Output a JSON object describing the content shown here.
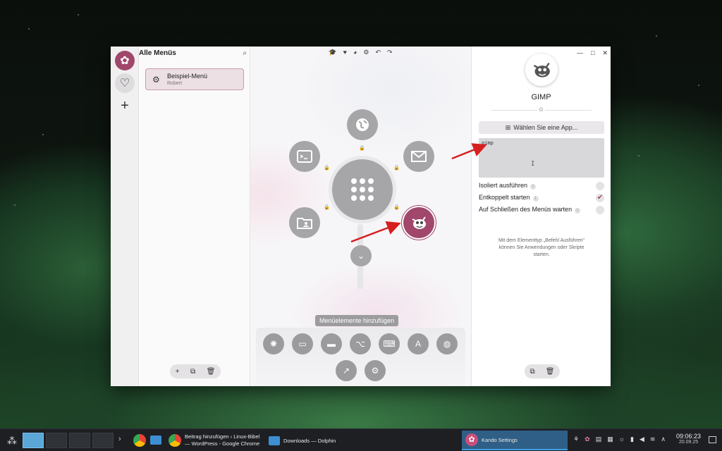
{
  "window": {
    "panel_title": "Alle Menüs",
    "menus": [
      {
        "name": "Beispiel-Menü",
        "subtitle": "Robert"
      }
    ]
  },
  "canvas": {
    "add_items_label": "Menüelemente hinzufügen"
  },
  "properties": {
    "item_name": "GIMP",
    "choose_app_label": "Wählen Sie eine App...",
    "command_value": "gimp",
    "options": [
      {
        "label": "Isoliert ausführen",
        "checked": false
      },
      {
        "label": "Entkoppelt starten",
        "checked": true
      },
      {
        "label": "Auf Schließen des Menüs warten",
        "checked": false
      }
    ],
    "hint": "Mit dem Elementtyp „Befehl Ausführen\" können Sie Anwendungen oder Skripte starten."
  },
  "taskbar": {
    "tasks": [
      {
        "label": "Beitrag hinzufügen ‹ Linux-Bibel — WordPress - Google Chrome"
      },
      {
        "label": "Downloads — Dolphin"
      },
      {
        "label": "Kando Settings"
      }
    ],
    "clock_time": "09:06:23",
    "clock_date": "20.09.25"
  },
  "colors": {
    "accent": "#a0476b",
    "taskbar": "#1d1f23"
  }
}
